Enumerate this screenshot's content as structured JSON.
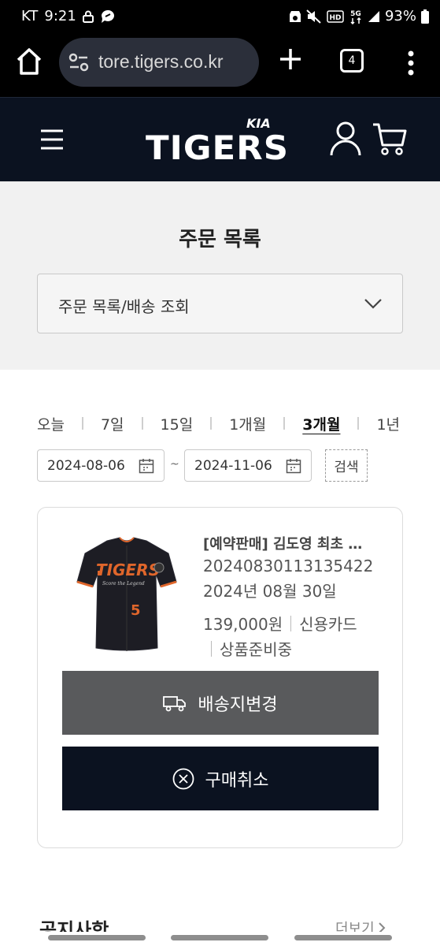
{
  "status_bar": {
    "carrier": "KT",
    "time": "9:21",
    "network": "5G",
    "battery": "93%"
  },
  "browser": {
    "url": "tore.tigers.co.kr",
    "tab_count": "4"
  },
  "site": {
    "logo_text": "TIGERS",
    "logo_brand": "KIA"
  },
  "page": {
    "title": "주문 목록",
    "select_value": "주문 목록/배송 조회"
  },
  "filters": {
    "periods": [
      "오늘",
      "7일",
      "15일",
      "1개월",
      "3개월",
      "1년"
    ],
    "active_period": "3개월",
    "date_from": "2024-08-06",
    "date_to": "2024-11-06",
    "tilde": "~",
    "search_label": "검색"
  },
  "order": {
    "product_name": "[예약판매] 김도영 최초 …",
    "order_number": "20240830113135422",
    "order_date": "2024년 08월 30일",
    "price": "139,000원",
    "payment": "신용카드",
    "status": "상품준비중",
    "jersey_text": "TIGERS",
    "jersey_number": "5",
    "change_address_label": "배송지변경",
    "cancel_label": "구매취소"
  },
  "notice": {
    "title": "공지사항",
    "more_label": "더보기"
  },
  "colors": {
    "header_bg": "#0b1220",
    "change_btn_bg": "#595a5c",
    "cancel_btn_bg": "#0b1220",
    "title_section_bg": "#f1f1f1"
  }
}
